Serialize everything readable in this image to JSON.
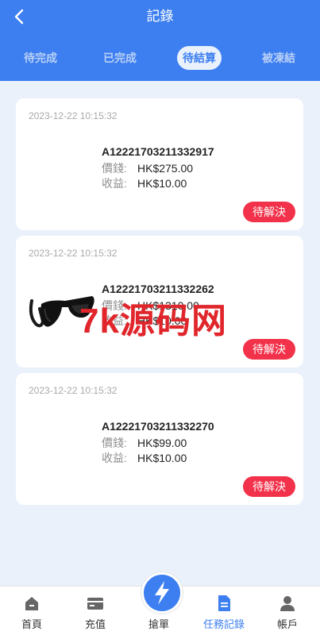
{
  "header": {
    "title": "記錄"
  },
  "tabs": [
    {
      "label": "待完成"
    },
    {
      "label": "已完成"
    },
    {
      "label": "待結算"
    },
    {
      "label": "被凍結"
    }
  ],
  "orders": [
    {
      "time": "2023-12-22 10:15:32",
      "order_no": "A12221703211332917",
      "price_label": "價錢:",
      "price": "HK$275.00",
      "profit_label": "收益:",
      "profit": "HK$10.00",
      "status": "待解決"
    },
    {
      "time": "2023-12-22 10:15:32",
      "order_no": "A12221703211332262",
      "price_label": "價錢:",
      "price": "HK$1310.00",
      "profit_label": "收益:",
      "profit": "HK$10.00",
      "status": "待解決"
    },
    {
      "time": "2023-12-22 10:15:32",
      "order_no": "A12221703211332270",
      "price_label": "價錢:",
      "price": "HK$99.00",
      "profit_label": "收益:",
      "profit": "HK$10.00",
      "status": "待解決"
    }
  ],
  "watermark": "7k源码网",
  "nav": [
    {
      "label": "首頁",
      "icon": "home-icon"
    },
    {
      "label": "充值",
      "icon": "card-icon"
    },
    {
      "label": "搶單",
      "icon": "lightning-icon"
    },
    {
      "label": "任務記錄",
      "icon": "document-icon"
    },
    {
      "label": "帳戶",
      "icon": "user-icon"
    }
  ],
  "colors": {
    "primary": "#3d7ff0",
    "status_button": "#f2324a",
    "background": "#eaf1fb"
  }
}
